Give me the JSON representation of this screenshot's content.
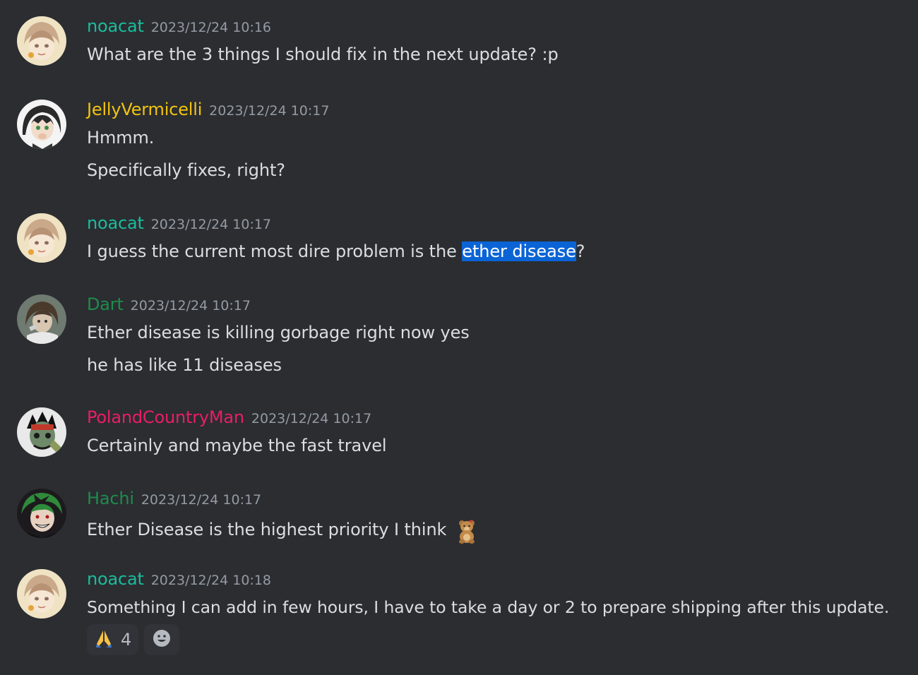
{
  "colors": {
    "background": "#2b2d31",
    "text": "#dbdee1",
    "timestamp": "#949ba4",
    "selection": "#0b64d6",
    "noacat": "#1abc9c",
    "JellyVermicelli": "#f1c40f",
    "Dart": "#1f8b4c",
    "PolandCountryMan": "#e91e63",
    "Hachi": "#1f8b4c"
  },
  "messages": [
    {
      "author": "noacat",
      "timestamp": "2023/12/24 10:16",
      "lines": [
        "What are the 3 things I should fix in the next update? :p"
      ]
    },
    {
      "author": "JellyVermicelli",
      "timestamp": "2023/12/24 10:17",
      "lines": [
        "Hmmm.",
        "Specifically fixes, right?"
      ]
    },
    {
      "author": "noacat",
      "timestamp": "2023/12/24 10:17",
      "line_before": "I guess the current most dire problem is the ",
      "line_selected": "ether disease",
      "line_after": "?"
    },
    {
      "author": "Dart",
      "timestamp": "2023/12/24 10:17",
      "lines": [
        "Ether disease is killing gorbage right now yes",
        "he has like 11 diseases"
      ]
    },
    {
      "author": "PolandCountryMan",
      "timestamp": "2023/12/24 10:17",
      "lines": [
        "Certainly and maybe the fast travel"
      ]
    },
    {
      "author": "Hachi",
      "timestamp": "2023/12/24 10:17",
      "lines": [
        "Ether Disease is the highest priority I think"
      ],
      "inline_emoji": "bear-plush-emoji"
    },
    {
      "author": "noacat",
      "timestamp": "2023/12/24 10:18",
      "lines": [
        "Something I can add in few hours, I have to take a day or 2 to prepare shipping after this update."
      ],
      "reactions": [
        {
          "emoji": "folded-hands-icon",
          "count": "4"
        }
      ],
      "add_reaction_icon": "smiley-face-icon"
    }
  ]
}
